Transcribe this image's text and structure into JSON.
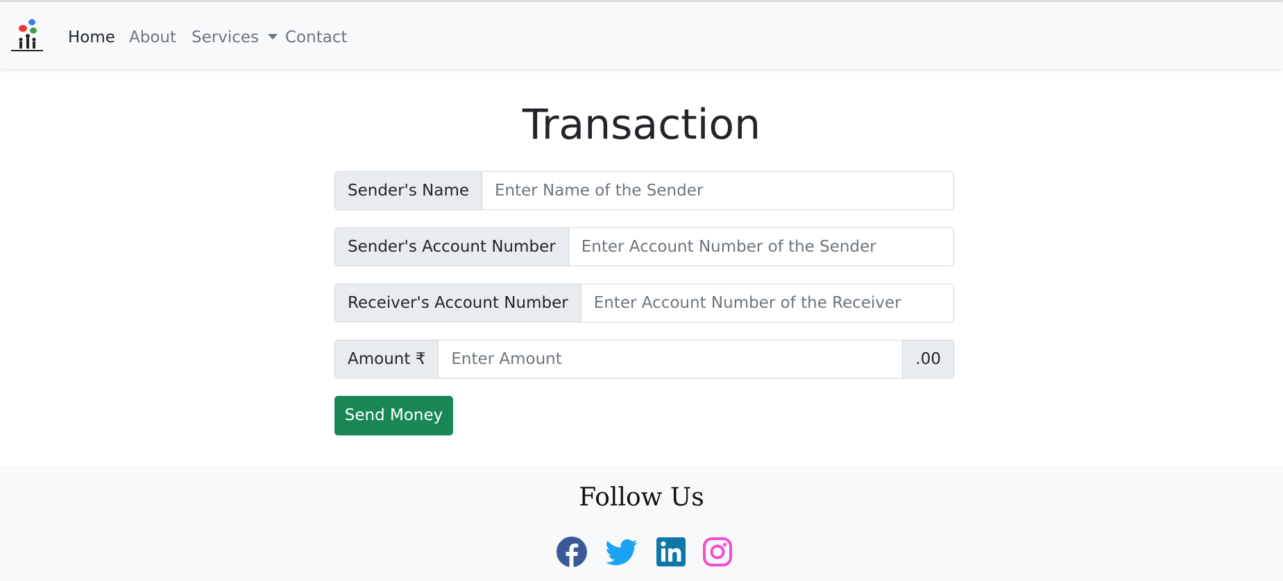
{
  "nav": {
    "logo_icon": "bank-people-logo",
    "items": [
      {
        "label": "Home",
        "active": true
      },
      {
        "label": "About",
        "active": false
      },
      {
        "label": "Services",
        "active": false,
        "dropdown": true
      },
      {
        "label": "Contact",
        "active": false
      }
    ]
  },
  "page": {
    "title": "Transaction"
  },
  "form": {
    "sender_name": {
      "label": "Sender's Name",
      "placeholder": "Enter Name of the Sender",
      "value": ""
    },
    "sender_account": {
      "label": "Sender's Account Number",
      "placeholder": "Enter Account Number of the Sender",
      "value": ""
    },
    "receiver_account": {
      "label": "Receiver's Account Number",
      "placeholder": "Enter Account Number of the Receiver",
      "value": ""
    },
    "amount": {
      "label": "Amount ₹",
      "placeholder": "Enter Amount",
      "suffix": ".00",
      "value": ""
    },
    "submit_label": "Send Money"
  },
  "footer": {
    "heading": "Follow Us",
    "social": [
      {
        "icon": "facebook-icon",
        "color": "#3b5998"
      },
      {
        "icon": "twitter-icon",
        "color": "#1da1f2"
      },
      {
        "icon": "linkedin-icon",
        "color": "#0e76a8"
      },
      {
        "icon": "instagram-icon",
        "color": "#f24dd6"
      }
    ]
  },
  "colors": {
    "navbar_bg": "#f8f9fa",
    "button_bg": "#198754",
    "addon_bg": "#e9ecef"
  }
}
